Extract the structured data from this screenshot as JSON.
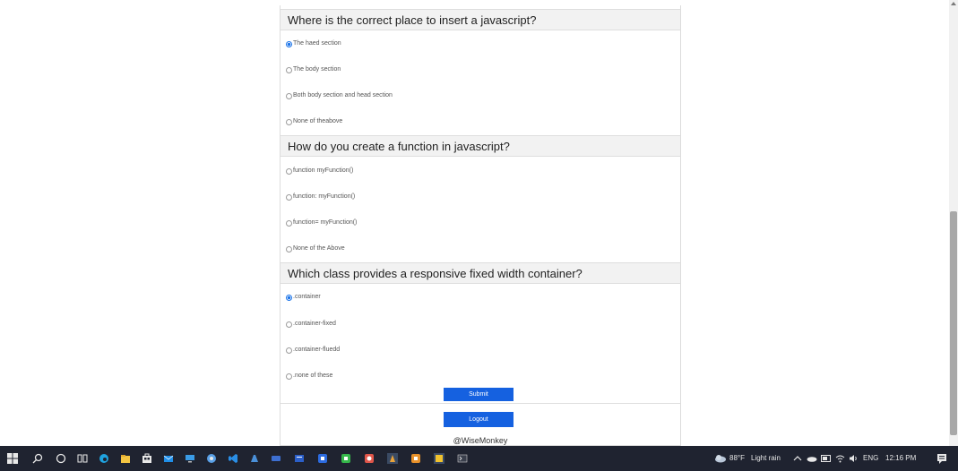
{
  "quiz": {
    "questions": [
      {
        "title": "Where is the correct place to insert a javascript?",
        "options": [
          "The haed section",
          "The body section",
          "Both body section and head section",
          "None of theabove"
        ],
        "selected": 0
      },
      {
        "title": "How do you create a function in javascript?",
        "options": [
          "function myFunction()",
          "function: myFunction()",
          "function= myFunction()",
          "None of the Above"
        ],
        "selected": -1
      },
      {
        "title": "Which class provides a responsive fixed width container?",
        "options": [
          ".container",
          ".container-fixed",
          ".container-fluedd",
          ".none of these"
        ],
        "selected": 0
      }
    ],
    "submit_label": "Submit",
    "logout_label": "Logout",
    "footer": "@WiseMonkey"
  },
  "taskbar": {
    "apps": [
      "windows-start-icon",
      "search-icon",
      "cortana-icon",
      "task-view-icon",
      "edge-icon",
      "file-explorer-icon",
      "store-icon",
      "mail-icon",
      "computer-icon",
      "chrome-icon",
      "vscode-icon",
      "app-icon",
      "app-icon",
      "app-icon",
      "app-icon",
      "app-icon",
      "app-icon",
      "app-icon",
      "app-icon",
      "app-icon",
      "terminal-icon"
    ],
    "weather_temp": "88°F",
    "weather_desc": "Light rain",
    "language": "ENG",
    "time": "12:16 PM"
  },
  "colors": {
    "accent": "#1561e0",
    "taskbar_bg": "#1f2330",
    "header_bg": "#f2f2f2"
  }
}
